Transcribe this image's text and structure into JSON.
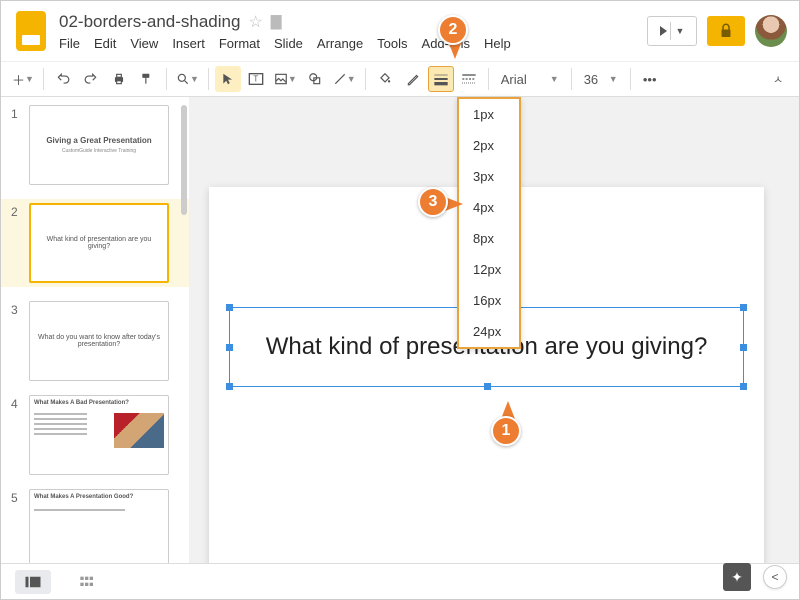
{
  "doc": {
    "title": "02-borders-and-shading"
  },
  "menu": {
    "file": "File",
    "edit": "Edit",
    "view": "View",
    "insert": "Insert",
    "format": "Format",
    "slide": "Slide",
    "arrange": "Arrange",
    "tools": "Tools",
    "addons": "Add-ons",
    "help": "Help"
  },
  "toolbar": {
    "font": "Arial",
    "size": "36"
  },
  "dropdown": {
    "items": [
      "1px",
      "2px",
      "3px",
      "4px",
      "8px",
      "12px",
      "16px",
      "24px"
    ]
  },
  "slides": [
    {
      "title": "Giving a Great Presentation",
      "sub": "CustomGuide Interactive Training"
    },
    {
      "body": "What kind of presentation are you giving?"
    },
    {
      "body": "What do you want to know after today's presentation?"
    },
    {
      "title": "What Makes A Bad Presentation?"
    },
    {
      "title": "What Makes A Presentation Good?"
    }
  ],
  "canvas": {
    "textbox": "What kind of presentation are you giving?"
  },
  "callouts": {
    "c1": "1",
    "c2": "2",
    "c3": "3"
  }
}
